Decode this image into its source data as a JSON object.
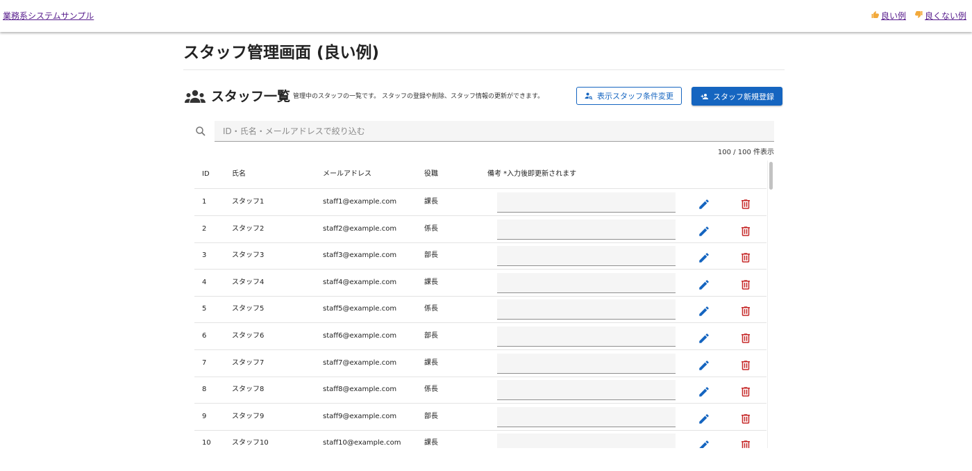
{
  "header": {
    "brand": "業務系システムサンプル",
    "nav": [
      {
        "label": "良い例",
        "icon": "thumbs-up-icon"
      },
      {
        "label": "良くない例",
        "icon": "thumbs-down-icon"
      }
    ]
  },
  "page": {
    "title": "スタッフ管理画面 (良い例)"
  },
  "section": {
    "title": "スタッフ一覧",
    "description": "管理中のスタッフの一覧です。 スタッフの登録や削除、スタッフ情報の更新ができます。",
    "filter_button": "表示スタッフ条件変更",
    "add_button": "スタッフ新規登録"
  },
  "search": {
    "placeholder": "ID・氏名・メールアドレスで絞り込む",
    "value": ""
  },
  "count": "100 / 100 件表示",
  "table": {
    "headers": {
      "id": "ID",
      "name": "氏名",
      "email": "メールアドレス",
      "role": "役職",
      "note": "備考 *入力後即更新されます"
    },
    "rows": [
      {
        "id": "1",
        "name": "スタッフ1",
        "email": "staff1@example.com",
        "role": "課長"
      },
      {
        "id": "2",
        "name": "スタッフ2",
        "email": "staff2@example.com",
        "role": "係長"
      },
      {
        "id": "3",
        "name": "スタッフ3",
        "email": "staff3@example.com",
        "role": "部長"
      },
      {
        "id": "4",
        "name": "スタッフ4",
        "email": "staff4@example.com",
        "role": "課長"
      },
      {
        "id": "5",
        "name": "スタッフ5",
        "email": "staff5@example.com",
        "role": "係長"
      },
      {
        "id": "6",
        "name": "スタッフ6",
        "email": "staff6@example.com",
        "role": "部長"
      },
      {
        "id": "7",
        "name": "スタッフ7",
        "email": "staff7@example.com",
        "role": "課長"
      },
      {
        "id": "8",
        "name": "スタッフ8",
        "email": "staff8@example.com",
        "role": "係長"
      },
      {
        "id": "9",
        "name": "スタッフ9",
        "email": "staff9@example.com",
        "role": "部長"
      },
      {
        "id": "10",
        "name": "スタッフ10",
        "email": "staff10@example.com",
        "role": "課長"
      }
    ]
  },
  "colors": {
    "primary": "#1565c0",
    "danger": "#c62828",
    "link": "#551a8b"
  }
}
